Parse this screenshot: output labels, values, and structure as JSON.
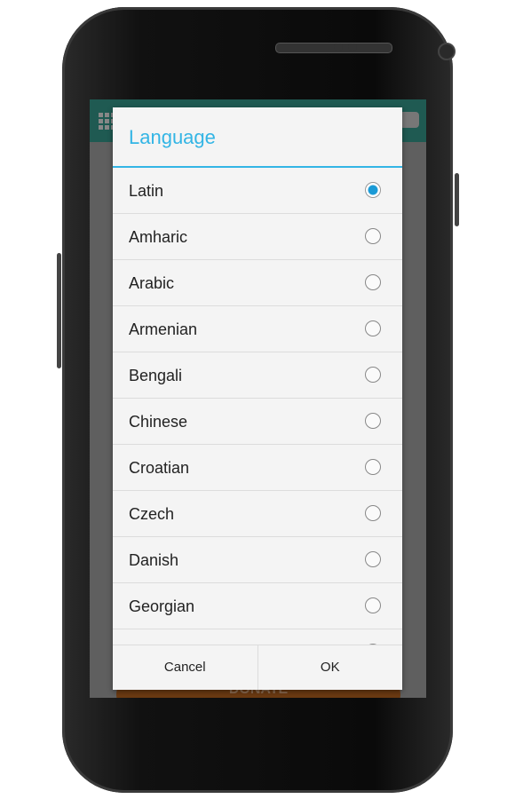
{
  "dialog": {
    "title": "Language",
    "options": [
      {
        "label": "Latin",
        "selected": true
      },
      {
        "label": "Amharic",
        "selected": false
      },
      {
        "label": "Arabic",
        "selected": false
      },
      {
        "label": "Armenian",
        "selected": false
      },
      {
        "label": "Bengali",
        "selected": false
      },
      {
        "label": "Chinese",
        "selected": false
      },
      {
        "label": "Croatian",
        "selected": false
      },
      {
        "label": "Czech",
        "selected": false
      },
      {
        "label": "Danish",
        "selected": false
      },
      {
        "label": "Georgian",
        "selected": false
      }
    ],
    "cancel_label": "Cancel",
    "ok_label": "OK"
  },
  "background": {
    "donate_label": "DONATE",
    "icons": [
      "grid-icon",
      "camera-icon"
    ]
  },
  "colors": {
    "accent": "#33b5e5",
    "appbar": "#1f5a52",
    "radio_selected": "#1a9ad6"
  }
}
